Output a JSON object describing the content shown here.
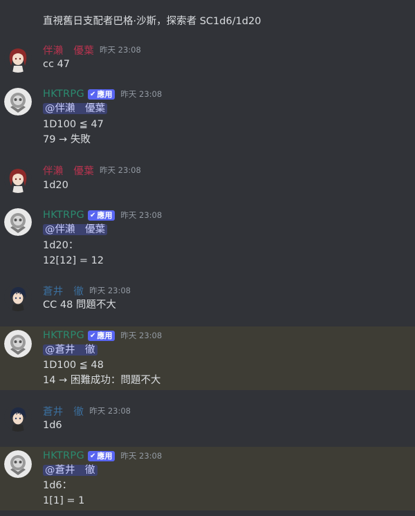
{
  "continuation_text": "直視舊日支配者巴格·沙斯，探索者 SC1d6/1d20",
  "colors": {
    "background": "#313338",
    "highlight_background": "#3e3d35",
    "user_a_name": "#b7344f",
    "user_b_name": "#3b6e9c",
    "bot_name": "#2b8a6f",
    "app_tag": "#5865f2",
    "mention_bg": "#3c4270"
  },
  "messages": [
    {
      "author": "伴瀨　優葉",
      "author_type": "user-a",
      "avatar_icon": "red-hair-character-avatar",
      "timestamp": "昨天 23:08",
      "lines": [
        "cc 47"
      ]
    },
    {
      "author": "HKTRPG",
      "author_type": "bot",
      "avatar_icon": "bot-logo-avatar",
      "tag": "應用",
      "timestamp": "昨天 23:08",
      "mention": "@伴瀨　優葉",
      "lines": [
        "1D100 ≦ 47",
        "79 → 失敗"
      ]
    },
    {
      "author": "伴瀨　優葉",
      "author_type": "user-a",
      "avatar_icon": "red-hair-character-avatar",
      "timestamp": "昨天 23:08",
      "lines": [
        "1d20"
      ]
    },
    {
      "author": "HKTRPG",
      "author_type": "bot",
      "avatar_icon": "bot-logo-avatar",
      "tag": "應用",
      "timestamp": "昨天 23:08",
      "mention": "@伴瀨　優葉",
      "lines": [
        "1d20：",
        "12[12] = 12"
      ]
    },
    {
      "author": "蒼井　徹",
      "author_type": "user-b",
      "avatar_icon": "dark-hair-character-avatar",
      "timestamp": "昨天 23:08",
      "lines": [
        "CC 48 問題不大"
      ]
    },
    {
      "author": "HKTRPG",
      "author_type": "bot",
      "avatar_icon": "bot-logo-avatar",
      "tag": "應用",
      "timestamp": "昨天 23:08",
      "mention": "@蒼井　徹",
      "lines": [
        "1D100 ≦ 48",
        "14 → 困難成功：問題不大"
      ]
    },
    {
      "author": "蒼井　徹",
      "author_type": "user-b",
      "avatar_icon": "dark-hair-character-avatar",
      "timestamp": "昨天 23:08",
      "lines": [
        "1d6"
      ]
    },
    {
      "author": "HKTRPG",
      "author_type": "bot",
      "avatar_icon": "bot-logo-avatar",
      "tag": "應用",
      "timestamp": "昨天 23:08",
      "mention": "@蒼井　徹",
      "lines": [
        "1d6：",
        "1[1] = 1"
      ]
    }
  ]
}
